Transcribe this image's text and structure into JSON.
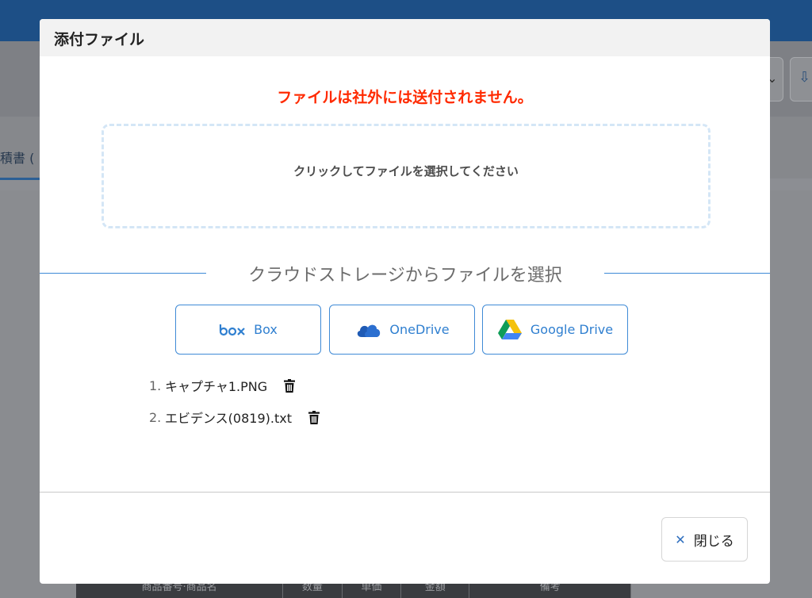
{
  "background": {
    "tab_label": "積書 (",
    "table_headers": [
      "商品番号·商品名",
      "数量",
      "単価",
      "金額",
      "備考"
    ]
  },
  "modal": {
    "title": "添付ファイル",
    "warning": "ファイルは社外には送付されません。",
    "dropzone_text": "クリックしてファイルを選択してください",
    "cloud_heading": "クラウドストレージからファイルを選択",
    "cloud_buttons": [
      {
        "label": "Box",
        "icon": "box-logo-icon"
      },
      {
        "label": "OneDrive",
        "icon": "onedrive-cloud-icon"
      },
      {
        "label": "Google Drive",
        "icon": "google-drive-icon"
      }
    ],
    "files": [
      {
        "num": "1.",
        "name": "キャプチャ1.PNG"
      },
      {
        "num": "2.",
        "name": "エビデンス(0819).txt"
      }
    ],
    "close_label": "閉じる"
  },
  "colors": {
    "warning": "#ff2a00",
    "accent": "#2f7fd0",
    "header_bar": "#1d4f86"
  }
}
